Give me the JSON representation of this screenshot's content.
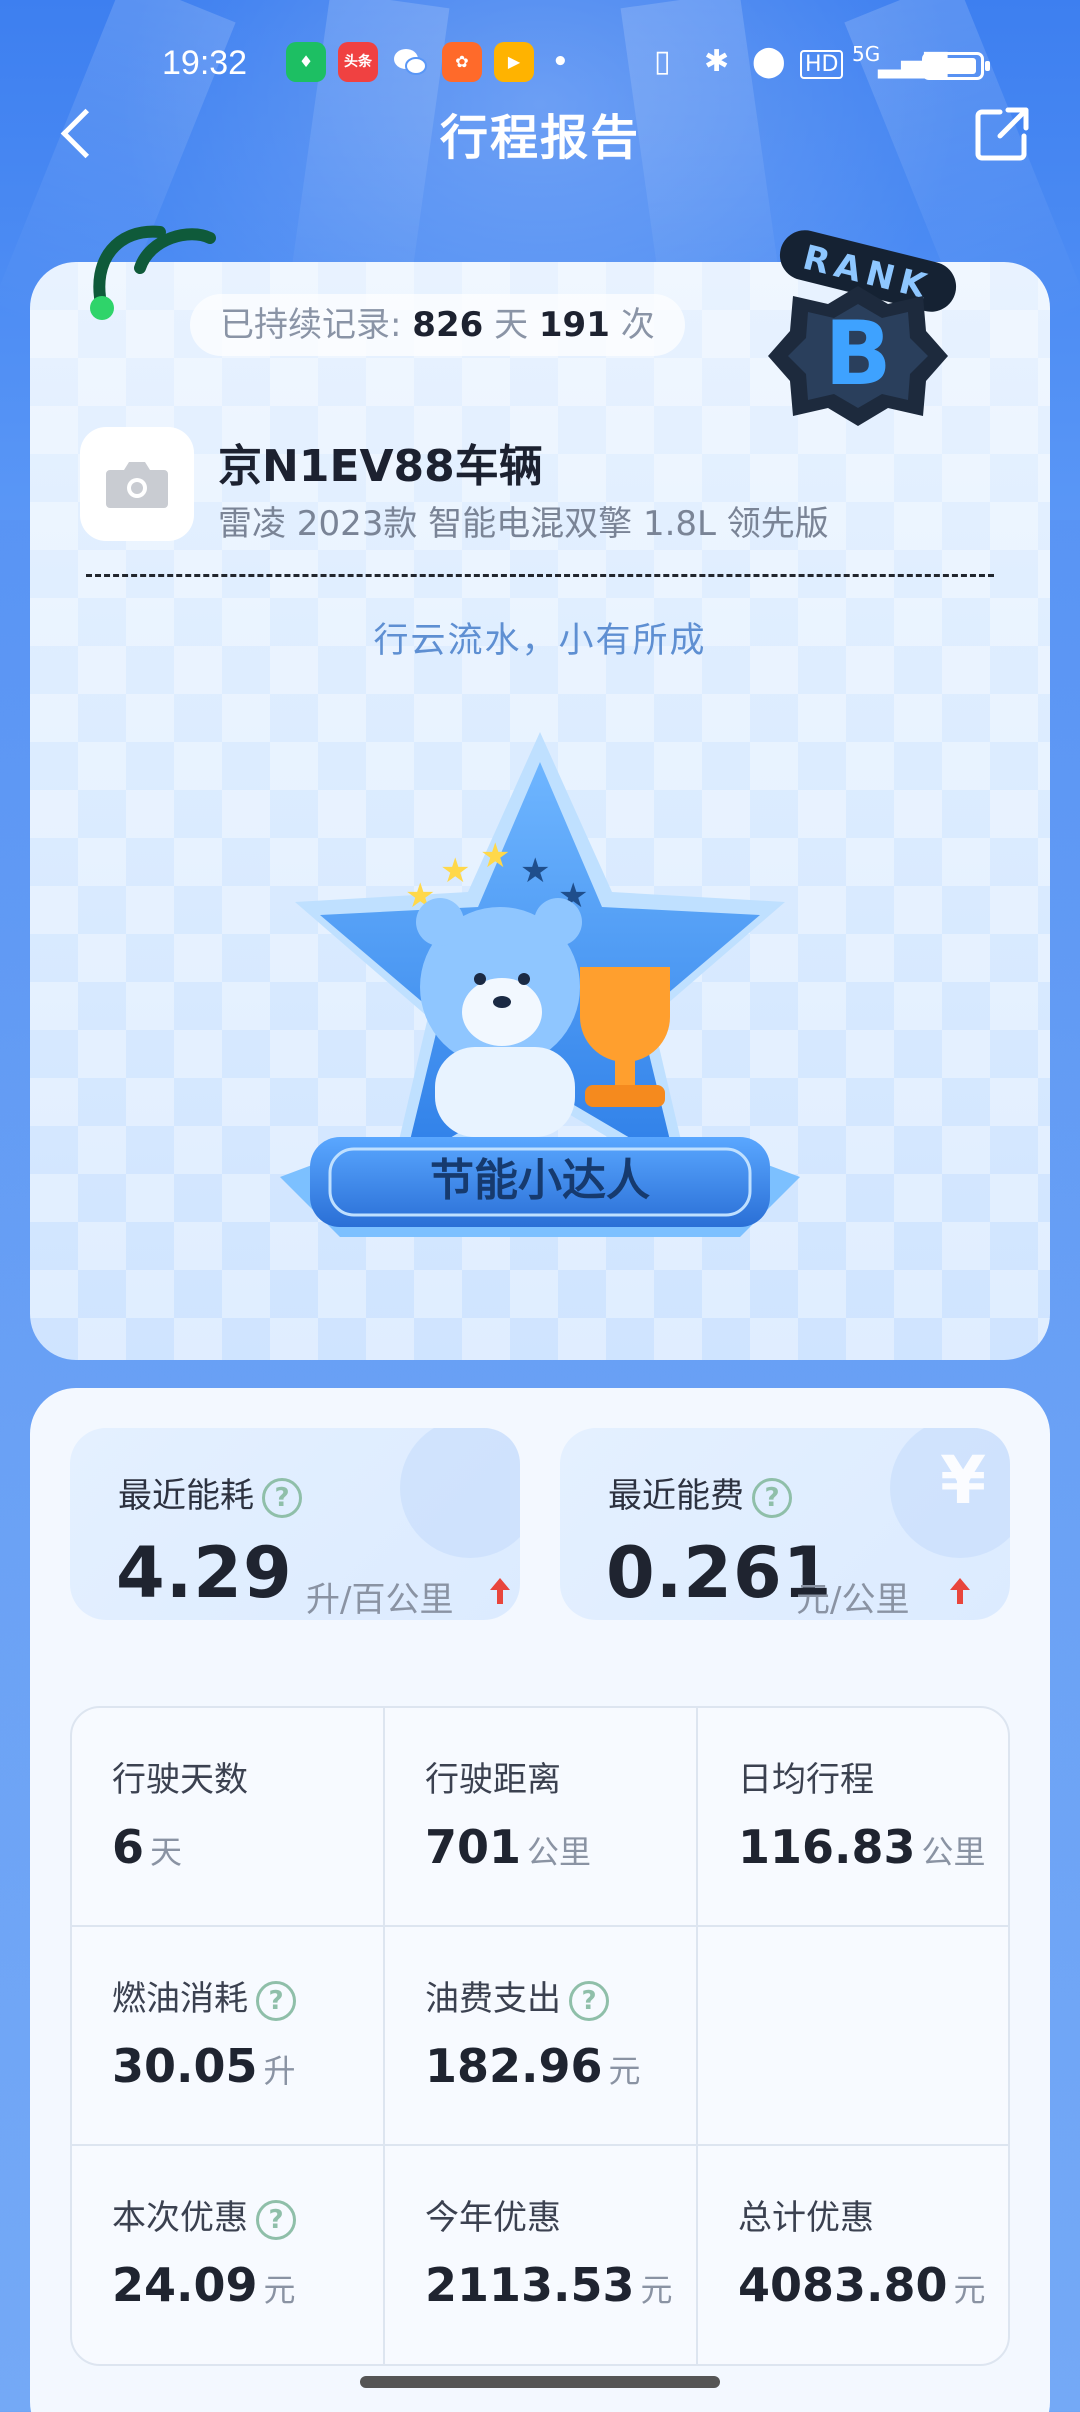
{
  "status_bar": {
    "time": "19:32",
    "notifications": [
      {
        "name": "app-green-icon",
        "color": "#1dbf63",
        "text": "♦"
      },
      {
        "name": "toutiao-icon",
        "color": "#f04141",
        "text": "头条"
      },
      {
        "name": "wechat-icon",
        "color": "#ffffff",
        "text": ""
      },
      {
        "name": "app-orange-icon",
        "color": "#ff6a2a",
        "text": "✿"
      },
      {
        "name": "app-video-icon",
        "color": "#ffb300",
        "text": "▶"
      }
    ],
    "network": "5G"
  },
  "nav": {
    "title": "行程报告"
  },
  "record": {
    "prefix": "已持续记录:",
    "days": "826",
    "days_unit": "天",
    "times": "191",
    "times_unit": "次"
  },
  "vehicle": {
    "plate_name": "京N1EV88车辆",
    "model": "雷凌 2023款 智能电混双擎 1.8L 领先版"
  },
  "slogan": "行云流水，小有所成",
  "rank": {
    "word": "RANK",
    "grade": "B"
  },
  "badge": {
    "title": "节能小达人",
    "stars_lit": 3,
    "stars_total": 5
  },
  "metrics": [
    {
      "label": "最近能耗",
      "value": "4.29",
      "unit": "升/百公里"
    },
    {
      "label": "最近能费",
      "value": "0.261",
      "unit": "元/公里"
    }
  ],
  "stats": [
    {
      "label": "行驶天数",
      "value": "6",
      "unit": "天",
      "help": false
    },
    {
      "label": "行驶距离",
      "value": "701",
      "unit": "公里",
      "help": false
    },
    {
      "label": "日均行程",
      "value": "116.83",
      "unit": "公里",
      "help": false
    },
    {
      "label": "燃油消耗",
      "value": "30.05",
      "unit": "升",
      "help": true
    },
    {
      "label": "油费支出",
      "value": "182.96",
      "unit": "元",
      "help": true
    },
    {
      "label": "",
      "value": "",
      "unit": "",
      "help": false
    },
    {
      "label": "本次优惠",
      "value": "24.09",
      "unit": "元",
      "help": true
    },
    {
      "label": "今年优惠",
      "value": "2113.53",
      "unit": "元",
      "help": false
    },
    {
      "label": "总计优惠",
      "value": "4083.80",
      "unit": "元",
      "help": false
    }
  ],
  "help_symbol": "?",
  "yen_symbol": "¥",
  "colors": {
    "accent": "#4f8ef5",
    "up_arrow": "#e8453c"
  }
}
